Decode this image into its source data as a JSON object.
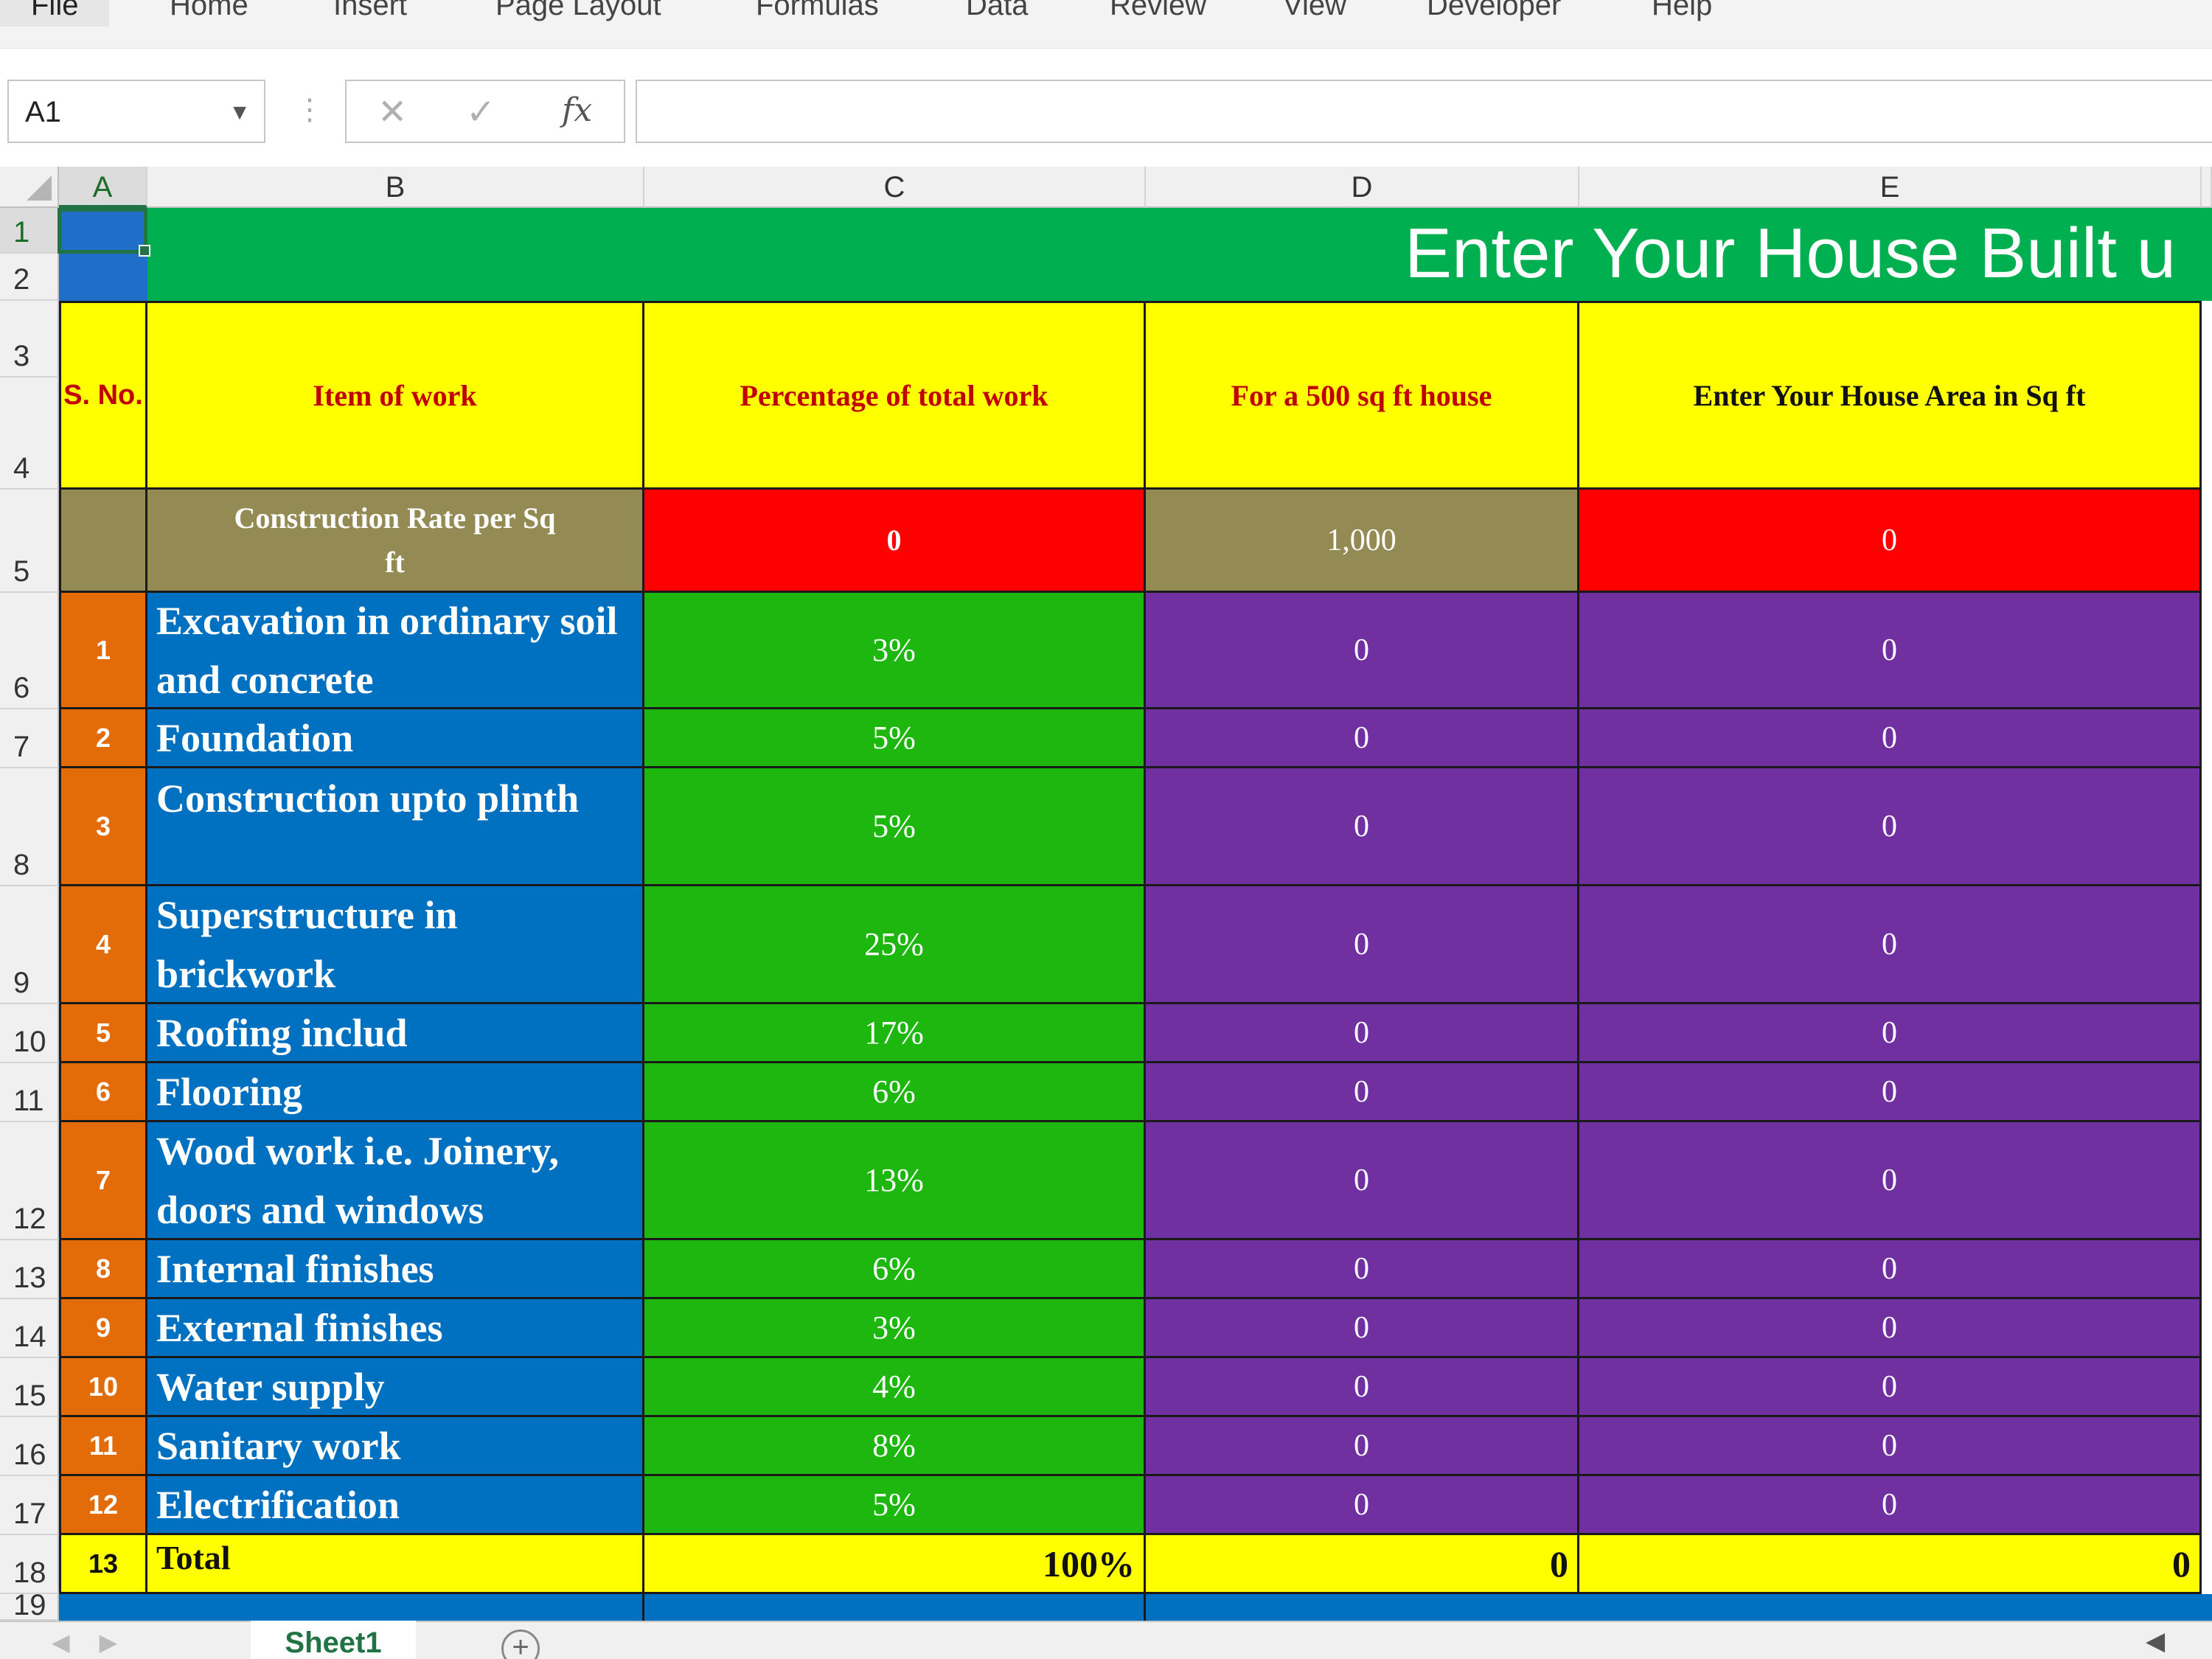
{
  "ribbon": {
    "tabs": [
      "File",
      "Home",
      "Insert",
      "Page Layout",
      "Formulas",
      "Data",
      "Review",
      "View",
      "Developer",
      "Help"
    ]
  },
  "formula_bar": {
    "name_box": "A1",
    "cancel_icon": "close-icon",
    "enter_icon": "check-icon",
    "fx_label": "fx",
    "content": ""
  },
  "columns": [
    "A",
    "B",
    "C",
    "D",
    "E"
  ],
  "rows": [
    "1",
    "2",
    "3",
    "4",
    "5",
    "6",
    "7",
    "8",
    "9",
    "10",
    "11",
    "12",
    "13",
    "14",
    "15",
    "16",
    "17",
    "18",
    "19"
  ],
  "sheet": {
    "title": "Enter Your House Built u",
    "headers": {
      "sno": "S. No.",
      "item": "Item of work",
      "percent": "Percentage of total work",
      "for500": "For a 500 sq ft house",
      "your_area": "Enter Your House Area in Sq ft"
    },
    "rate_row": {
      "label": "Construction Rate per Sq ft",
      "c": "0",
      "d": "1,000",
      "e": "0"
    },
    "items": [
      {
        "sno": "1",
        "item": "Excavation in ordinary soil and concrete",
        "percent": "3%",
        "d": "0",
        "e": "0"
      },
      {
        "sno": "2",
        "item": "Foundation",
        "percent": "5%",
        "d": "0",
        "e": "0"
      },
      {
        "sno": "3",
        "item": "Construction upto plinth",
        "percent": "5%",
        "d": "0",
        "e": "0"
      },
      {
        "sno": "4",
        "item": "Superstructure in brickwork",
        "percent": "25%",
        "d": "0",
        "e": "0"
      },
      {
        "sno": "5",
        "item": "Roofing includ",
        "percent": "17%",
        "d": "0",
        "e": "0"
      },
      {
        "sno": "6",
        "item": "Flooring",
        "percent": "6%",
        "d": "0",
        "e": "0"
      },
      {
        "sno": "7",
        "item": "Wood work i.e. Joinery, doors and windows",
        "percent": "13%",
        "d": "0",
        "e": "0"
      },
      {
        "sno": "8",
        "item": "Internal finishes",
        "percent": "6%",
        "d": "0",
        "e": "0"
      },
      {
        "sno": "9",
        "item": "External finishes",
        "percent": "3%",
        "d": "0",
        "e": "0"
      },
      {
        "sno": "10",
        "item": "Water supply",
        "percent": "4%",
        "d": "0",
        "e": "0"
      },
      {
        "sno": "11",
        "item": "Sanitary work",
        "percent": "8%",
        "d": "0",
        "e": "0"
      },
      {
        "sno": "12",
        "item": "Electrification",
        "percent": "5%",
        "d": "0",
        "e": "0"
      }
    ],
    "total_row": {
      "sno": "13",
      "label": "Total",
      "percent": "100%",
      "d": "0",
      "e": "0"
    }
  },
  "sheet_tabs": {
    "active": "Sheet1",
    "add_icon": "plus-circle-icon"
  },
  "colors": {
    "title_band": "#00b050",
    "header_yellow": "#ffff00",
    "header_red_text": "#c00000",
    "rate_olive": "#948a54",
    "rate_red": "#ff0000",
    "sno_orange": "#e36c09",
    "item_blue": "#0070c0",
    "percent_green": "#1db710",
    "value_purple": "#7030a0"
  }
}
